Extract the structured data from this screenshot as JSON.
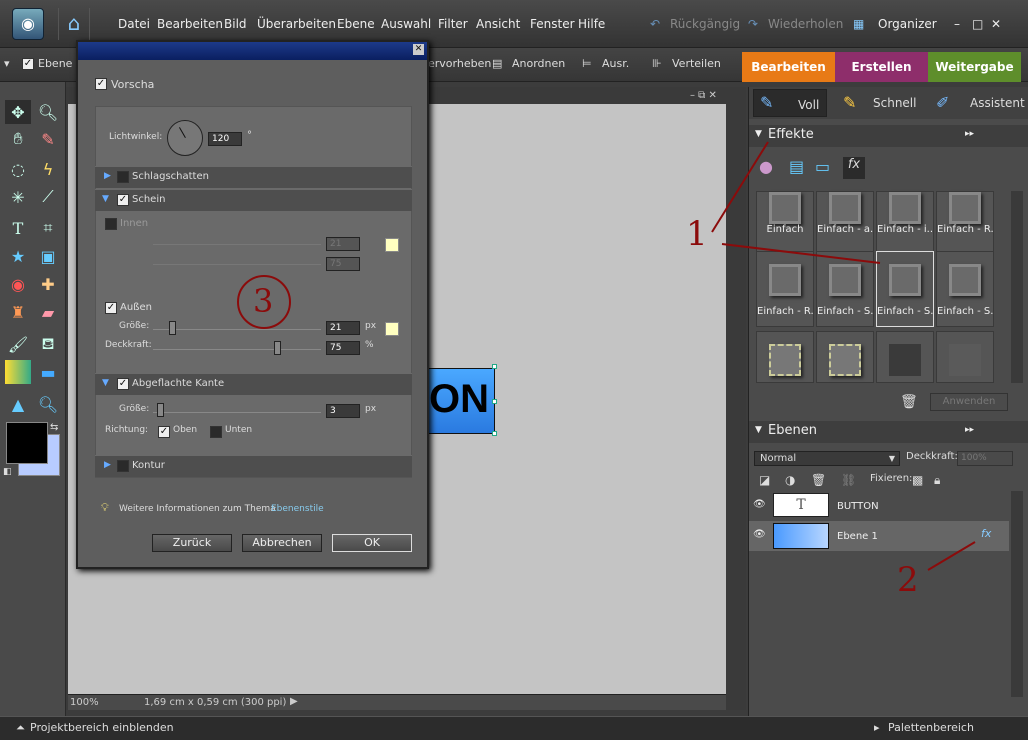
{
  "menubar": {
    "items": [
      "Datei",
      "Bearbeiten",
      "Bild",
      "Überarbeiten",
      "Ebene",
      "Auswahl",
      "Filter",
      "Ansicht",
      "Fenster",
      "Hilfe"
    ],
    "undo": "Rückgängig",
    "redo": "Wiederholen",
    "organizer": "Organizer"
  },
  "optbar": {
    "layer_cb_label": "Ebene au",
    "vorheben": "ervorheben",
    "arrange": "Anordnen",
    "align": "Ausr.",
    "distribute": "Verteilen"
  },
  "mode_tabs": [
    {
      "label": "Bearbeiten",
      "color": "#e87a16"
    },
    {
      "label": "Erstellen",
      "color": "#8e2e6b"
    },
    {
      "label": "Weitergabe",
      "color": "#5e8e2b"
    }
  ],
  "edit_modes": [
    "Voll",
    "Schnell",
    "Assistent"
  ],
  "effects_panel": {
    "title": "Effekte",
    "tiles": [
      "Einfach",
      "Einfach - a...",
      "Einfach - i...",
      "Einfach - R...",
      "Einfach - R...",
      "Einfach - S...",
      "Einfach - S...",
      "Einfach - S...",
      "",
      "",
      "",
      ""
    ],
    "apply": "Anwenden"
  },
  "layers_panel": {
    "title": "Ebenen",
    "blend_mode": "Normal",
    "opacity_label": "Deckkraft:",
    "opacity_value": "100%",
    "lock_label": "Fixieren:",
    "layers": [
      {
        "name": "BUTTON",
        "thumb": "T"
      },
      {
        "name": "Ebene 1",
        "fx": "fx"
      }
    ]
  },
  "canvas": {
    "button_text": "ON",
    "zoom": "100%",
    "doc_info": "1,69 cm x 0,59 cm (300 ppi)"
  },
  "bottombar": {
    "left": "Projektbereich einblenden",
    "right": "Palettenbereich"
  },
  "dialog": {
    "preview_label": "Vorscha",
    "light_angle_label": "Lichtwinkel:",
    "light_angle_value": "120",
    "degree": "°",
    "drop_shadow": "Schlagschatten",
    "glow": "Schein",
    "inner": "Innen",
    "inner_size": "21",
    "inner_opacity": "75",
    "outer": "Außen",
    "size_label": "Größe:",
    "outer_size": "21",
    "px": "px",
    "opacity_label": "Deckkraft:",
    "outer_opacity": "75",
    "percent": "%",
    "bevel": "Abgeflachte Kante",
    "bevel_size": "3",
    "direction_label": "Richtung:",
    "up": "Oben",
    "down": "Unten",
    "stroke": "Kontur",
    "info_text": "Weitere Informationen zum Thema",
    "info_link": "Ebenenstile",
    "back": "Zurück",
    "cancel": "Abbrechen",
    "ok": "OK"
  },
  "annotations": [
    "1",
    "2",
    "3"
  ]
}
